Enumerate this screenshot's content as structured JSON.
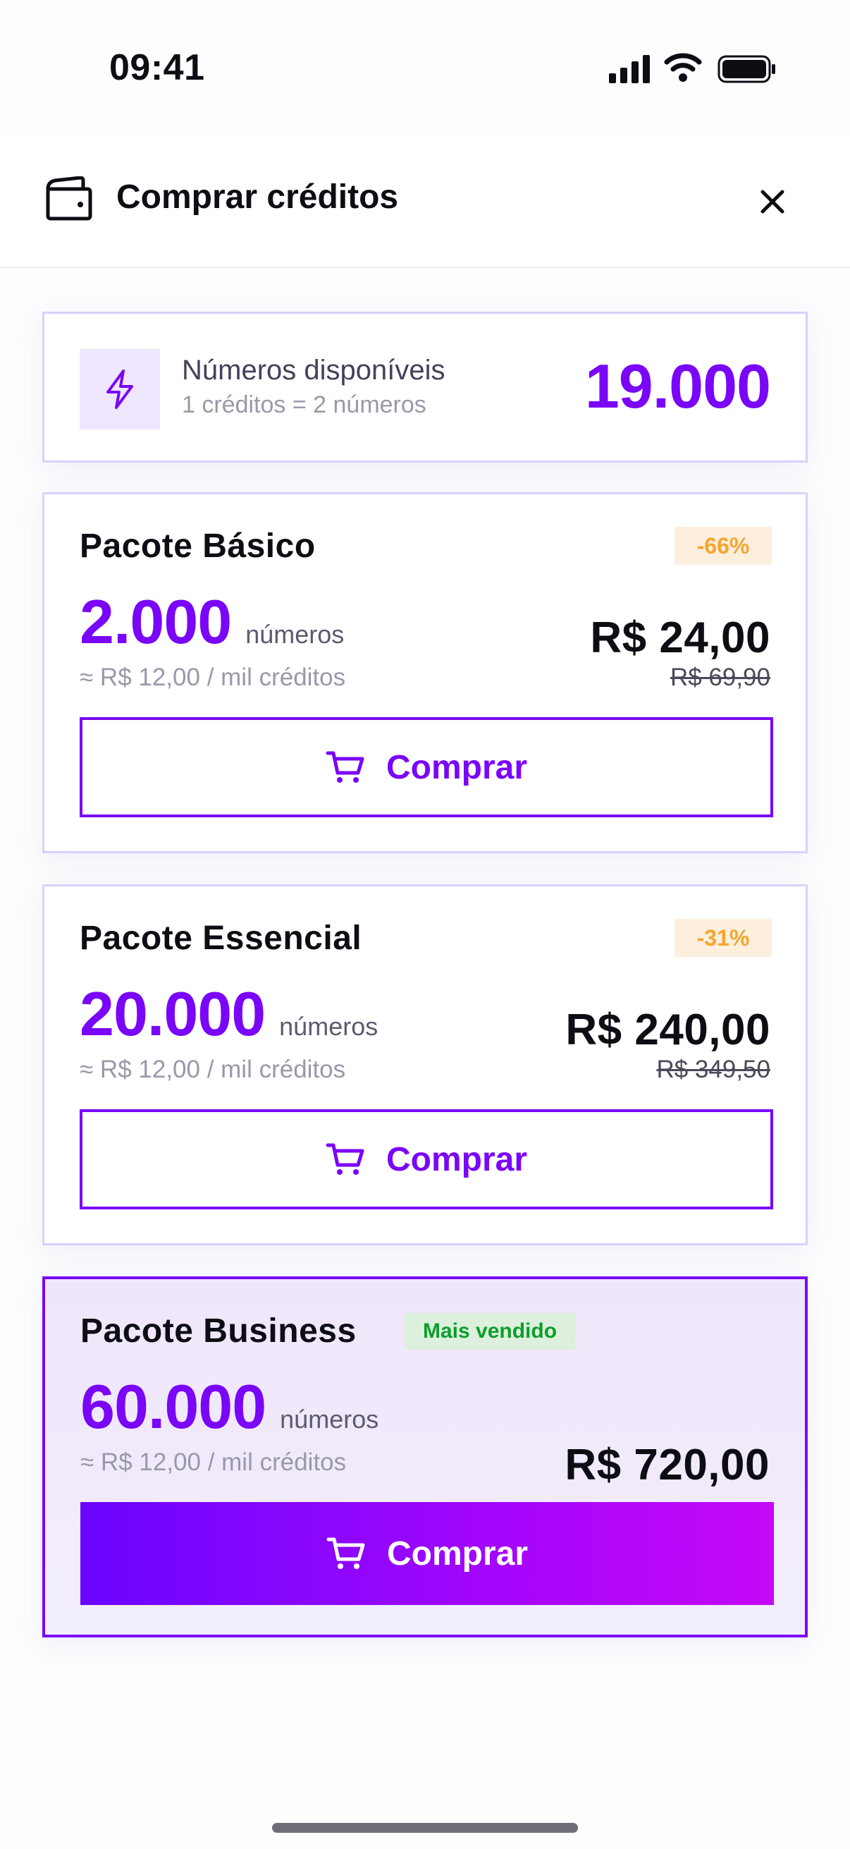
{
  "status_bar": {
    "time": "09:41"
  },
  "header": {
    "title": "Comprar créditos"
  },
  "balance": {
    "label": "Números disponíveis",
    "sub": "1 créditos = 2 números",
    "value": "19.000"
  },
  "packages": [
    {
      "title": "Pacote Básico",
      "badge": "-66%",
      "amount": "2.000",
      "unit": "números",
      "rate": "≈ R$ 12,00 / mil créditos",
      "price": "R$ 24,00",
      "old_price": "R$ 69,90",
      "button": "Comprar"
    },
    {
      "title": "Pacote Essencial",
      "badge": "-31%",
      "amount": "20.000",
      "unit": "números",
      "rate": "≈ R$ 12,00 / mil créditos",
      "price": "R$ 240,00",
      "old_price": "R$ 349,50",
      "button": "Comprar"
    },
    {
      "title": "Pacote Business",
      "badge": "Mais vendido",
      "amount": "60.000",
      "unit": "números",
      "rate": "≈ R$ 12,00 / mil créditos",
      "price": "R$ 720,00",
      "button": "Comprar"
    }
  ],
  "colors": {
    "accent": "#7a06f7",
    "discount_bg": "#fcefde",
    "discount_text": "#f5a530",
    "best_bg": "#dcf0dd",
    "best_text": "#0d9e2a",
    "gradient_start": "#6a05ff",
    "gradient_end": "#c507f7"
  },
  "icons": {
    "wallet": "wallet-icon",
    "close": "close-icon",
    "bolt": "bolt-icon",
    "cart": "cart-icon"
  }
}
